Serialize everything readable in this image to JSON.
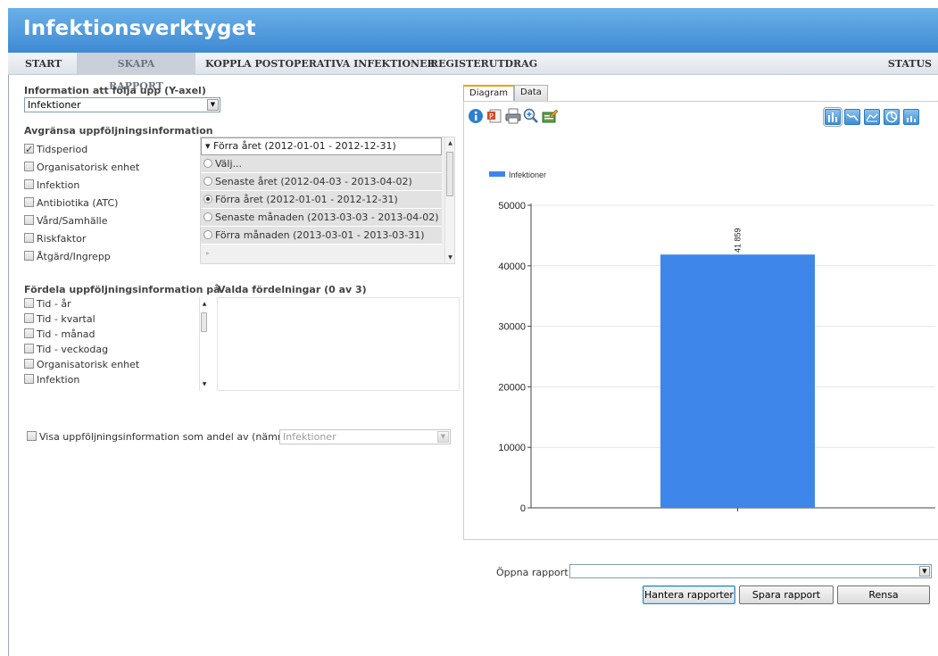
{
  "app": {
    "title": "Infektionsverktyget"
  },
  "nav": {
    "items": [
      {
        "label": "START"
      },
      {
        "label": "SKAPA RAPPORT",
        "active": true
      },
      {
        "label": "KOPPLA POSTOPERATIVA INFEKTIONER"
      },
      {
        "label": "REGISTERUTDRAG"
      },
      {
        "label": "STATUS"
      }
    ]
  },
  "yaxis": {
    "label": "Information att följa upp (Y-axel)",
    "selected": "Infektioner"
  },
  "limit": {
    "heading": "Avgränsa uppföljningsinformation",
    "items": [
      {
        "label": "Tidsperiod",
        "checked": true
      },
      {
        "label": "Organisatorisk enhet",
        "checked": false
      },
      {
        "label": "Infektion",
        "checked": false
      },
      {
        "label": "Antibiotika (ATC)",
        "checked": false
      },
      {
        "label": "Vård/Samhälle",
        "checked": false
      },
      {
        "label": "Riskfaktor",
        "checked": false
      },
      {
        "label": "Åtgärd/Ingrepp",
        "checked": false
      }
    ],
    "period_header": "▾ Förra året (2012-01-01 - 2012-12-31)",
    "period_options": [
      {
        "label": "Välj...",
        "selected": false
      },
      {
        "label": "Senaste året (2012-04-03 - 2013-04-02)",
        "selected": false
      },
      {
        "label": "Förra året (2012-01-01 - 2012-12-31)",
        "selected": true
      },
      {
        "label": "Senaste månaden (2013-03-03 - 2013-04-02)",
        "selected": false
      },
      {
        "label": "Förra månaden (2013-03-01 - 2013-03-31)",
        "selected": false
      }
    ]
  },
  "distribute": {
    "heading": "Fördela uppföljningsinformation på",
    "selected_heading": "Valda fördelningar (0 av 3)",
    "items": [
      {
        "label": "Tid - år"
      },
      {
        "label": "Tid - kvartal"
      },
      {
        "label": "Tid - månad"
      },
      {
        "label": "Tid - veckodag"
      },
      {
        "label": "Organisatorisk enhet"
      },
      {
        "label": "Infektion"
      }
    ]
  },
  "ratio": {
    "label": "Visa uppföljningsinformation som andel av (nämnare)",
    "checked": false,
    "value": "Infektioner"
  },
  "tabs": [
    {
      "label": "Diagram",
      "active": true
    },
    {
      "label": "Data"
    }
  ],
  "toolbar": {
    "left_icons": [
      "info-icon",
      "export-powerpoint-icon",
      "print-icon",
      "zoom-icon",
      "edit-chart-icon"
    ],
    "chart_type_icons": [
      "bar-chart-icon",
      "line-chart-icon",
      "area-chart-icon",
      "pie-chart-icon",
      "column-chart-icon"
    ]
  },
  "colors": {
    "header": "#4a96da",
    "bar": "#3f86ea"
  },
  "chart_data": {
    "type": "bar",
    "categories": [
      ""
    ],
    "series": [
      {
        "name": "Infektioner",
        "values": [
          41859
        ]
      }
    ],
    "data_labels": [
      "41 859"
    ],
    "yticks": [
      "0",
      "10000",
      "20000",
      "30000",
      "40000",
      "50000"
    ],
    "ylim": [
      0,
      50000
    ],
    "legend": "top-left",
    "grid": true
  },
  "open_report": {
    "label": "Öppna rapport",
    "value": ""
  },
  "buttons": {
    "manage": "Hantera rapporter",
    "save": "Spara rapport",
    "clear": "Rensa"
  }
}
